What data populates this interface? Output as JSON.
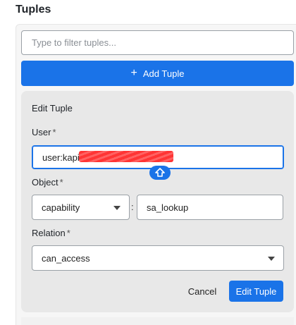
{
  "heading": "Tuples",
  "filter": {
    "placeholder": "Type to filter tuples..."
  },
  "add_button": {
    "label": "Add Tuple",
    "icon": "plus-icon"
  },
  "edit_form": {
    "title": "Edit Tuple",
    "user": {
      "label": "User",
      "required_mark": "*",
      "value": "user:kapi"
    },
    "object": {
      "label": "Object",
      "required_mark": "*",
      "type_value": "capability",
      "separator": ":",
      "id_value": "sa_lookup"
    },
    "relation": {
      "label": "Relation",
      "required_mark": "*",
      "value": "can_access"
    },
    "cancel_label": "Cancel",
    "submit_label": "Edit Tuple"
  },
  "colors": {
    "primary": "#1a73e8",
    "card_bg": "#e8e8e8",
    "redaction": "#ff2a2a"
  }
}
